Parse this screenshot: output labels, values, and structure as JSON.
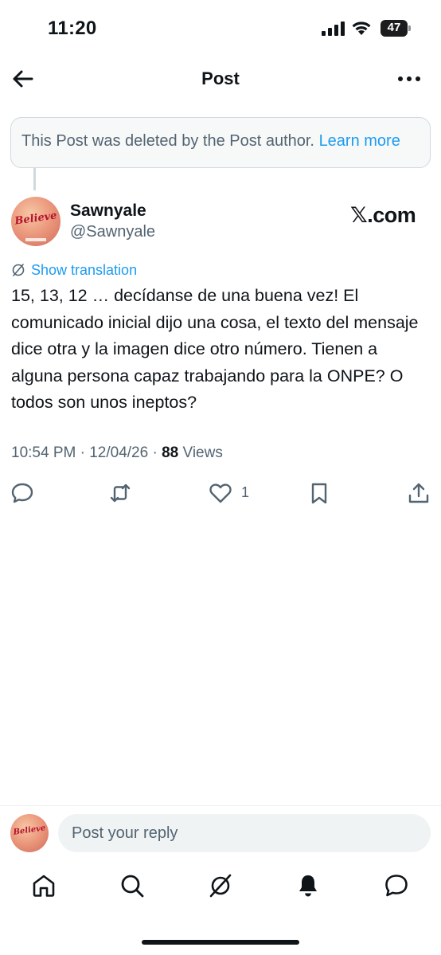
{
  "status_bar": {
    "time": "11:20",
    "battery": "47"
  },
  "nav": {
    "title": "Post",
    "back_icon": "arrow-left-icon",
    "more_icon": "more-horizontal-icon"
  },
  "deleted_notice": {
    "text": "This Post was deleted by the Post author.",
    "link": "Learn more"
  },
  "post": {
    "author_name": "Sawnyale",
    "author_handle": "@Sawnyale",
    "avatar_text": "Believe",
    "watermark": "𝕏.com",
    "show_translation": "Show translation",
    "text": "15, 13, 12 … decídanse de una buena vez! El comunicado inicial dijo una cosa, el texto del mensaje dice otra y la imagen dice otro número. Tienen a alguna persona capaz trabajando para la ONPE? O todos son unos ineptos?",
    "time": "10:54 PM",
    "date": "12/04/26",
    "views_count": "88",
    "views_label": "Views",
    "likes": "1"
  },
  "reply": {
    "placeholder": "Post your reply"
  },
  "tabs": [
    "home-icon",
    "search-icon",
    "grok-icon",
    "notifications-icon",
    "messages-icon"
  ],
  "colors": {
    "accent": "#1d9bf0",
    "text": "#0f1419",
    "secondary": "#536471"
  }
}
